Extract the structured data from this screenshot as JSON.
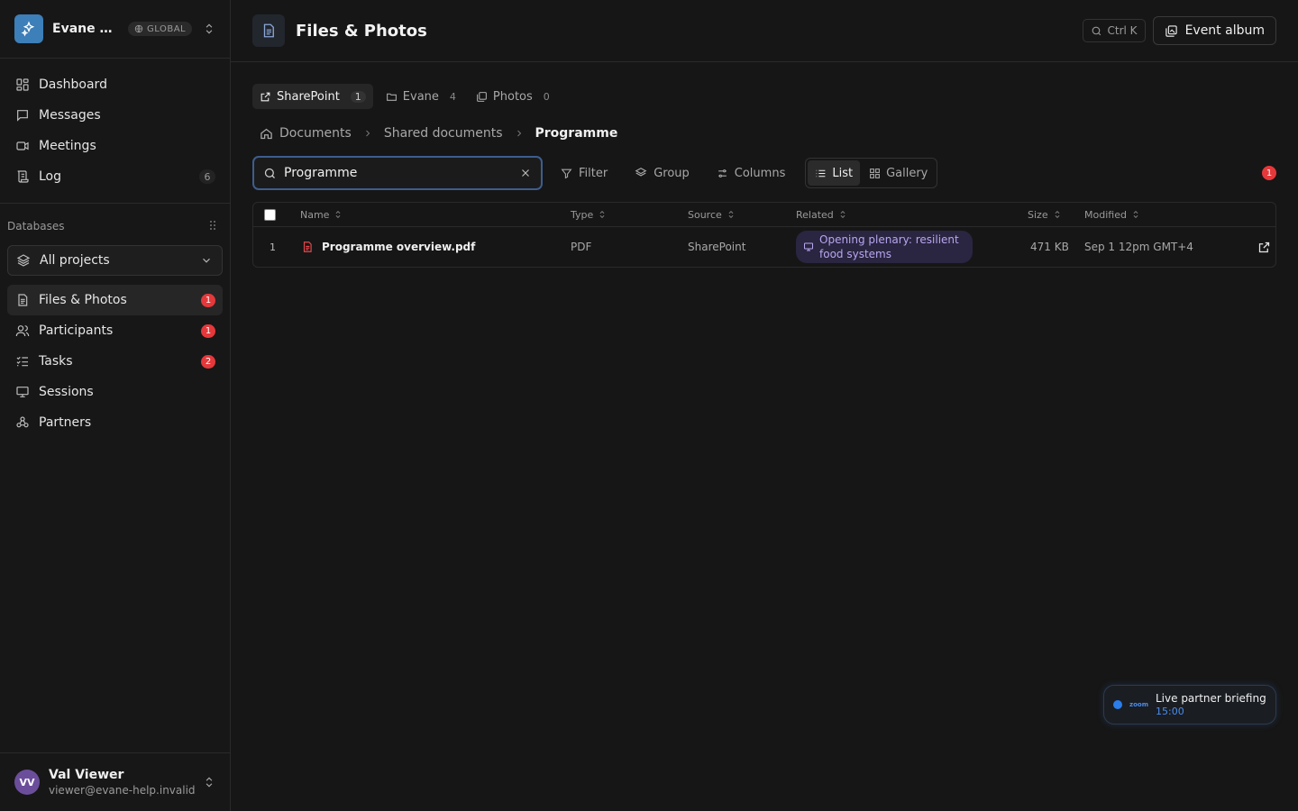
{
  "workspace": {
    "name": "Evane He...",
    "badge": "GLOBAL"
  },
  "nav": {
    "items": [
      {
        "label": "Dashboard",
        "icon": "dashboard-icon"
      },
      {
        "label": "Messages",
        "icon": "message-icon"
      },
      {
        "label": "Meetings",
        "icon": "video-icon"
      },
      {
        "label": "Log",
        "icon": "scroll-icon",
        "count": "6"
      }
    ]
  },
  "databases": {
    "heading": "Databases",
    "project_select": "All projects",
    "items": [
      {
        "label": "Files & Photos",
        "badge": "1",
        "active": true
      },
      {
        "label": "Participants",
        "badge": "1"
      },
      {
        "label": "Tasks",
        "badge": "2"
      },
      {
        "label": "Sessions"
      },
      {
        "label": "Partners"
      }
    ]
  },
  "user": {
    "initials": "VV",
    "name": "Val Viewer",
    "email": "viewer@evane-help.invalid"
  },
  "header": {
    "title": "Files & Photos",
    "shortcut": "Ctrl K",
    "album_button": "Event album"
  },
  "source_tabs": [
    {
      "label": "SharePoint",
      "count": "1",
      "active": true
    },
    {
      "label": "Evane",
      "count": "4"
    },
    {
      "label": "Photos",
      "count": "0"
    }
  ],
  "breadcrumb": [
    "Documents",
    "Shared documents",
    "Programme"
  ],
  "toolbar": {
    "search_value": "Programme",
    "filter": "Filter",
    "group": "Group",
    "columns": "Columns",
    "view_list": "List",
    "view_gallery": "Gallery",
    "alert_count": "1"
  },
  "table": {
    "headers": {
      "name": "Name",
      "type": "Type",
      "source": "Source",
      "related": "Related",
      "size": "Size",
      "modified": "Modified"
    },
    "rows": [
      {
        "num": "1",
        "name": "Programme overview.pdf",
        "type": "PDF",
        "source": "SharePoint",
        "related_line1": "Opening plenary: resilient",
        "related_line2": "food systems",
        "size": "471 KB",
        "modified": "Sep 1 12pm GMT+4"
      }
    ]
  },
  "live_briefing": {
    "logo": "zoom",
    "title": "Live partner briefing",
    "time": "15:00"
  },
  "colors": {
    "accent_blue": "#3d7fb8",
    "badge_red": "#e5383b",
    "related_purple": "#b9a7f0",
    "pdf_red": "#e5484d"
  }
}
